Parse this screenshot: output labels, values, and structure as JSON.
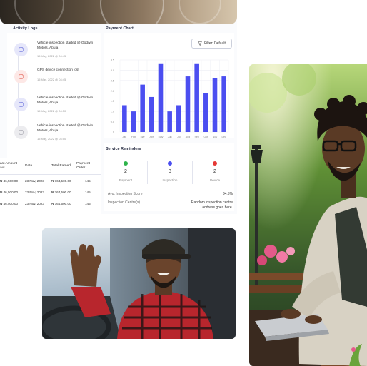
{
  "activity_logs": {
    "title": "Activity Logs",
    "items": [
      {
        "text": "Vehicle inspection started @ Godwin Motors, Abuja",
        "date": "15 May, 2022 @ 04:45",
        "color": "#5b63d9",
        "bg": "#e6e7fa"
      },
      {
        "text": "GPS device connection lost",
        "date": "15 May, 2022 @ 04:45",
        "color": "#e0574c",
        "bg": "#fde8e6"
      },
      {
        "text": "Vehicle inspection started @ Godwin Motors, Abuja",
        "date": "15 May, 2022 @ 04:50",
        "color": "#5b63d9",
        "bg": "#e6e7fa"
      },
      {
        "text": "Vehicle inspection started @ Godwin Motors, Abuja",
        "date": "15 May, 2022 @ 04:50",
        "color": "#9a9aa4",
        "bg": "#ececef"
      }
    ]
  },
  "payments_table": {
    "headers": [
      "ast Amount aid",
      "Date",
      "Total Earned",
      "Payment Order"
    ],
    "rows": [
      [
        "₦ 46,500.00",
        "23 Nov, 2023",
        "₦ 764,500.00",
        "145"
      ],
      [
        "₦ 46,500.00",
        "23 Nov, 2023",
        "₦ 764,500.00",
        "145"
      ],
      [
        "₦ 46,500.00",
        "23 Nov, 2023",
        "₦ 764,500.00",
        "145"
      ]
    ]
  },
  "payment_chart": {
    "title": "Payment Chart",
    "filter_label": "Filter: Default"
  },
  "chart_data": {
    "type": "bar",
    "categories": [
      "Jan",
      "Feb",
      "Mar",
      "Apr",
      "May",
      "Jun",
      "Jul",
      "Aug",
      "Sep",
      "Oct",
      "Nov",
      "Dec"
    ],
    "values": [
      1.3,
      1.0,
      2.3,
      1.7,
      3.3,
      1.0,
      1.3,
      2.7,
      3.3,
      1.9,
      2.6,
      2.7
    ],
    "yticks": [
      "3.5",
      "3.0",
      "2.5",
      "2.0",
      "1.5",
      "1.0",
      "0.5",
      "0"
    ],
    "ylim": [
      0,
      3.5
    ],
    "bar_color": "#4b4ef0",
    "grid": true
  },
  "service_reminders": {
    "title": "Service Reminders",
    "items": [
      {
        "count": "2",
        "label": "Payment",
        "color": "#2db34a"
      },
      {
        "count": "3",
        "label": "Inspection",
        "color": "#4b4ef0"
      },
      {
        "count": "2",
        "label": "Device",
        "color": "#e53935"
      }
    ],
    "avg_score_label": "Avg. Inspection Score",
    "avg_score_value": "34.5%",
    "centre_label": "Inspection Centre(s)",
    "centre_value": "Random inspection centre address goes here."
  },
  "photos": {
    "driver": "driver-photo",
    "laptop_man": "laptop-man-photo"
  }
}
